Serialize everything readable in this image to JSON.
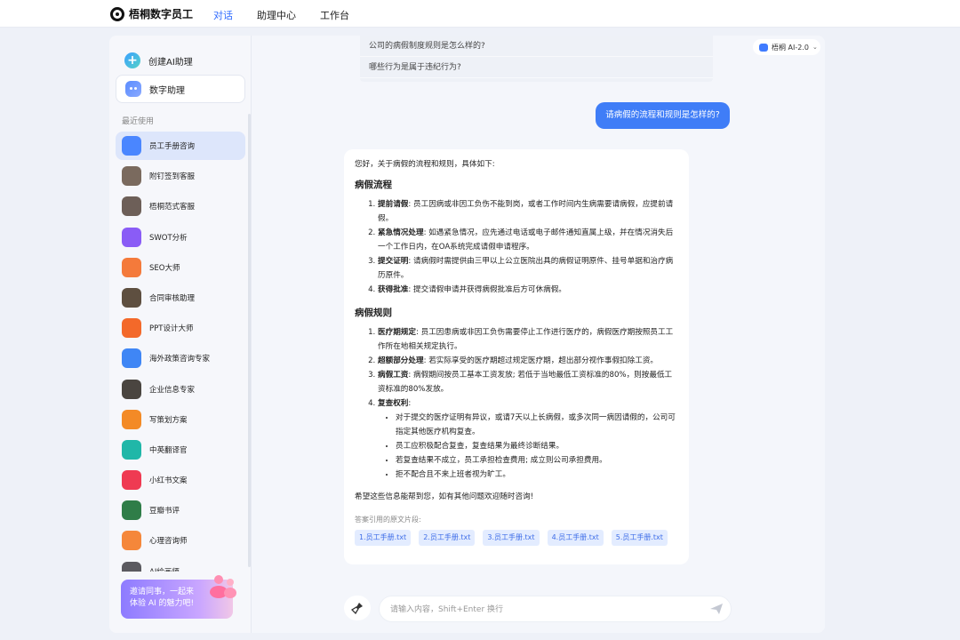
{
  "brand": {
    "name": "梧桐数字员工"
  },
  "nav": [
    {
      "label": "对话",
      "active": true
    },
    {
      "label": "助理中心",
      "active": false
    },
    {
      "label": "工作台",
      "active": false
    }
  ],
  "sidebar": {
    "create_label": "创建AI助理",
    "digital_label": "数字助理",
    "recent_label": "最近使用",
    "items": [
      {
        "label": "员工手册咨询",
        "icon": "book-icon",
        "color": "#4a86ff",
        "active": true
      },
      {
        "label": "附钉签到客服",
        "icon": "person-avatar",
        "color": "#7a6a5e"
      },
      {
        "label": "梧桐范式客服",
        "icon": "person-avatar",
        "color": "#6d5f58"
      },
      {
        "label": "SWOT分析",
        "icon": "swot-icon",
        "color": "#8a5cf6"
      },
      {
        "label": "SEO大师",
        "icon": "seo-icon",
        "color": "#f47a3b"
      },
      {
        "label": "合同审核助理",
        "icon": "person-avatar",
        "color": "#5e4f40"
      },
      {
        "label": "PPT设计大师",
        "icon": "ppt-icon",
        "color": "#f3692a"
      },
      {
        "label": "海外政策咨询专家",
        "icon": "globe-icon",
        "color": "#3f86f5"
      },
      {
        "label": "企业信息专家",
        "icon": "person-avatar",
        "color": "#4a4540"
      },
      {
        "label": "写策划方案",
        "icon": "atom-icon",
        "color": "#f38a26"
      },
      {
        "label": "中英翻译官",
        "icon": "translate-icon",
        "color": "#20b7a8"
      },
      {
        "label": "小红书文案",
        "icon": "redbook-icon",
        "color": "#ef3a52"
      },
      {
        "label": "豆瓣书评",
        "icon": "douban-icon",
        "color": "#2f7d48"
      },
      {
        "label": "心理咨询师",
        "icon": "heartbeat-icon",
        "color": "#f5873a"
      },
      {
        "label": "AI绘画师",
        "icon": "person-avatar",
        "color": "#5b5a60"
      }
    ],
    "banner": {
      "line1": "邀请同事，一起来",
      "line2": "体验 AI 的魅力吧!"
    }
  },
  "model": {
    "label": "梧桐 AI-2.0"
  },
  "suggestions": [
    "公司的病假制度规则是怎么样的?",
    "哪些行为是属于违纪行为?"
  ],
  "user_message": "请病假的流程和规则是怎样的?",
  "answer": {
    "intro": "您好，关于病假的流程和规则，具体如下:",
    "section1_title": "病假流程",
    "section1_items": [
      {
        "bold": "提前请假",
        "text": ": 员工因病或非因工负伤不能到岗，或者工作时间内生病需要请病假，应提前请假。"
      },
      {
        "bold": "紧急情况处理",
        "text": ": 如遇紧急情况，应先通过电话或电子邮件通知直属上级，并在情况消失后一个工作日内，在OA系统完成请假申请程序。"
      },
      {
        "bold": "提交证明",
        "text": ": 请病假时需提供由三甲以上公立医院出具的病假证明原件、挂号单据和治疗病历原件。"
      },
      {
        "bold": "获得批准",
        "text": ": 提交请假申请并获得病假批准后方可休病假。"
      }
    ],
    "section2_title": "病假规则",
    "section2_items": [
      {
        "bold": "医疗期规定",
        "text": ": 员工因患病或非因工负伤需要停止工作进行医疗的，病假医疗期按照员工工作所在地相关规定执行。"
      },
      {
        "bold": "超额部分处理",
        "text": ": 若实际享受的医疗期超过规定医疗期，超出部分视作事假扣除工资。"
      },
      {
        "bold": "病假工资",
        "text": ": 病假期间按员工基本工资发放; 若低于当地最低工资标准的80%，则按最低工资标准的80%发放。"
      },
      {
        "bold": "复查权利",
        "text": ":"
      }
    ],
    "review_points": [
      "对于提交的医疗证明有异议，或请7天以上长病假，或多次同一病因请假的，公司可指定其他医疗机构复查。",
      "员工应积极配合复查，复查结果为最终诊断结果。",
      "若复查结果不成立，员工承担检查费用; 成立则公司承担费用。",
      "拒不配合且不来上班者视为旷工。"
    ],
    "closing": "希望这些信息能帮到您，如有其他问题欢迎随时咨询!",
    "citation_label": "答案引用的原文片段:",
    "citations": [
      "1.员工手册.txt",
      "2.员工手册.txt",
      "3.员工手册.txt",
      "4.员工手册.txt",
      "5.员工手册.txt"
    ]
  },
  "input": {
    "placeholder": "请输入内容，Shift+Enter 换行"
  },
  "colors": {
    "accent": "#2f6bff",
    "bubble": "#3f7df7",
    "citation_bg": "#e3ecff"
  }
}
